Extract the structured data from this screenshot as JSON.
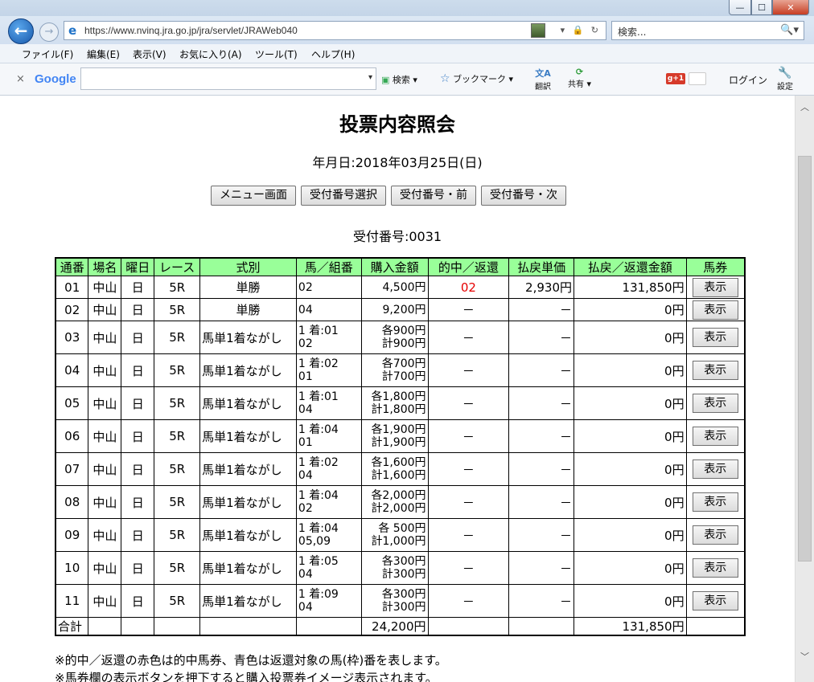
{
  "window": {
    "min": "—",
    "max": "☐",
    "close": "✕"
  },
  "nav": {
    "url": "https://www.nvinq.jra.go.jp/jra/servlet/JRAWeb040",
    "addr_tools": "▾ 🔒 ↻",
    "search_placeholder": "検索...",
    "search_icon": "🔍▾"
  },
  "menu": [
    "ファイル(F)",
    "編集(E)",
    "表示(V)",
    "お気に入り(A)",
    "ツール(T)",
    "ヘルプ(H)"
  ],
  "google": {
    "close": "×",
    "logo": "Google",
    "input_arrow": "▾",
    "search": "検索",
    "bookmark": "ブックマーク",
    "translate": "翻訳",
    "share": "共有",
    "gplus": "g+1",
    "login": "ログイン",
    "settings": "設定"
  },
  "page": {
    "title": "投票内容照会",
    "date": "年月日:2018年03月25日(日)",
    "buttons": [
      "メニュー画面",
      "受付番号選択",
      "受付番号・前",
      "受付番号・次"
    ],
    "receipt": "受付番号:0031"
  },
  "table": {
    "headers": [
      "通番",
      "場名",
      "曜日",
      "レース",
      "式別",
      "馬／組番",
      "購入金額",
      "的中／返還",
      "払戻単価",
      "払戻／返還金額",
      "馬券"
    ],
    "show_label": "表示",
    "rows": [
      {
        "no": "01",
        "venue": "中山",
        "day": "日",
        "race": "5R",
        "type": "単勝",
        "combo1": "02",
        "combo2": "",
        "amt1": "4,500円",
        "amt2": "",
        "hit": "02",
        "unit": "2,930円",
        "payout": "131,850円"
      },
      {
        "no": "02",
        "venue": "中山",
        "day": "日",
        "race": "5R",
        "type": "単勝",
        "combo1": "04",
        "combo2": "",
        "amt1": "9,200円",
        "amt2": "",
        "hit": "－",
        "unit": "－",
        "payout": "0円"
      },
      {
        "no": "03",
        "venue": "中山",
        "day": "日",
        "race": "5R",
        "type": "馬単1着ながし",
        "combo1": "1 着:01",
        "combo2": "02",
        "amt1": "各900円",
        "amt2": "計900円",
        "hit": "－",
        "unit": "－",
        "payout": "0円"
      },
      {
        "no": "04",
        "venue": "中山",
        "day": "日",
        "race": "5R",
        "type": "馬単1着ながし",
        "combo1": "1 着:02",
        "combo2": "01",
        "amt1": "各700円",
        "amt2": "計700円",
        "hit": "－",
        "unit": "－",
        "payout": "0円"
      },
      {
        "no": "05",
        "venue": "中山",
        "day": "日",
        "race": "5R",
        "type": "馬単1着ながし",
        "combo1": "1 着:01",
        "combo2": "04",
        "amt1": "各1,800円",
        "amt2": "計1,800円",
        "hit": "－",
        "unit": "－",
        "payout": "0円"
      },
      {
        "no": "06",
        "venue": "中山",
        "day": "日",
        "race": "5R",
        "type": "馬単1着ながし",
        "combo1": "1 着:04",
        "combo2": "01",
        "amt1": "各1,900円",
        "amt2": "計1,900円",
        "hit": "－",
        "unit": "－",
        "payout": "0円"
      },
      {
        "no": "07",
        "venue": "中山",
        "day": "日",
        "race": "5R",
        "type": "馬単1着ながし",
        "combo1": "1 着:02",
        "combo2": "04",
        "amt1": "各1,600円",
        "amt2": "計1,600円",
        "hit": "－",
        "unit": "－",
        "payout": "0円"
      },
      {
        "no": "08",
        "venue": "中山",
        "day": "日",
        "race": "5R",
        "type": "馬単1着ながし",
        "combo1": "1 着:04",
        "combo2": "02",
        "amt1": "各2,000円",
        "amt2": "計2,000円",
        "hit": "－",
        "unit": "－",
        "payout": "0円"
      },
      {
        "no": "09",
        "venue": "中山",
        "day": "日",
        "race": "5R",
        "type": "馬単1着ながし",
        "combo1": "1 着:04",
        "combo2": "05,09",
        "amt1": "各 500円",
        "amt2": "計1,000円",
        "hit": "－",
        "unit": "－",
        "payout": "0円"
      },
      {
        "no": "10",
        "venue": "中山",
        "day": "日",
        "race": "5R",
        "type": "馬単1着ながし",
        "combo1": "1 着:05",
        "combo2": "04",
        "amt1": "各300円",
        "amt2": "計300円",
        "hit": "－",
        "unit": "－",
        "payout": "0円"
      },
      {
        "no": "11",
        "venue": "中山",
        "day": "日",
        "race": "5R",
        "type": "馬単1着ながし",
        "combo1": "1 着:09",
        "combo2": "04",
        "amt1": "各300円",
        "amt2": "計300円",
        "hit": "－",
        "unit": "－",
        "payout": "0円"
      }
    ],
    "total": {
      "label": "合計",
      "amount": "24,200円",
      "payout": "131,850円"
    }
  },
  "notes": [
    "※的中／返還の赤色は的中馬券、青色は返還対象の馬(枠)番を表します。",
    "※馬券欄の表示ボタンを押下すると購入投票券イメージ表示されます。"
  ],
  "colors": {
    "header_bg": "#99ff99",
    "hit_red": "#e60000"
  }
}
